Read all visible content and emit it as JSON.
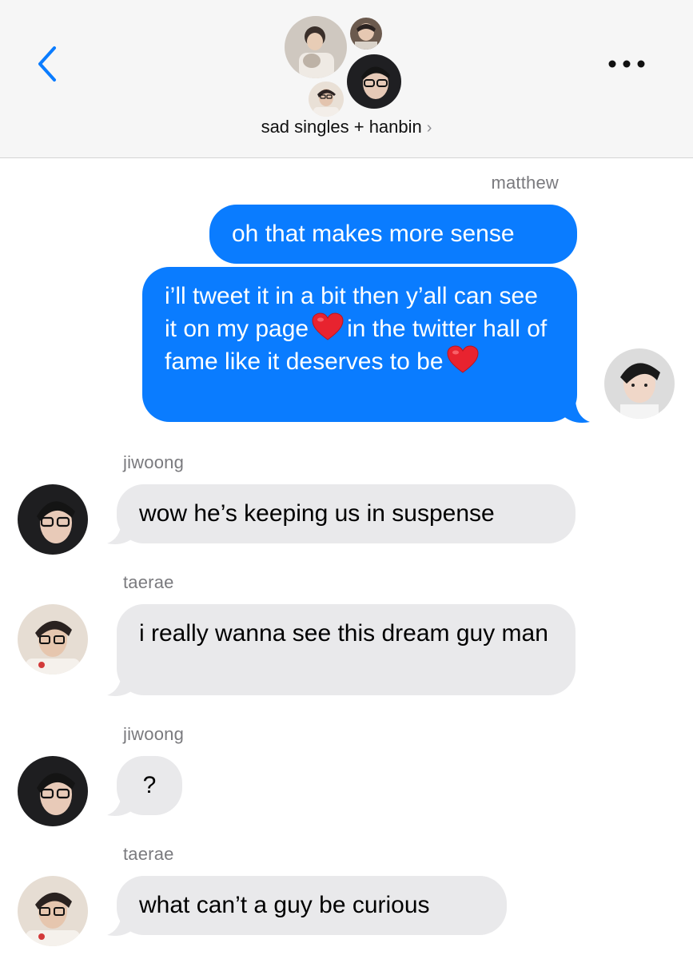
{
  "header": {
    "title": "sad singles + hanbin",
    "chevron": "›",
    "back_icon": "chevron-left-icon",
    "more_icon": "ellipsis-icon",
    "accent": "#0a7cff"
  },
  "messages": [
    {
      "sender": "matthew",
      "direction": "out",
      "text": "oh that makes more sense"
    },
    {
      "direction": "out",
      "text_parts": [
        "i’ll tweet it in a bit then y’all can see it on my page",
        "in the twitter hall of fame like it deserves to be",
        ""
      ],
      "emoji": "red-heart"
    },
    {
      "sender": "jiwoong",
      "direction": "in",
      "text": "wow he’s keeping us in suspense"
    },
    {
      "sender": "taerae",
      "direction": "in",
      "text": "i really wanna see this dream guy man"
    },
    {
      "sender": "jiwoong",
      "direction": "in",
      "text": "?"
    },
    {
      "sender": "taerae",
      "direction": "in",
      "text": "what can’t a guy be curious"
    }
  ],
  "colors": {
    "outgoing_bubble": "#0a7cff",
    "incoming_bubble": "#e9e9eb",
    "header_bg": "#f6f6f6"
  }
}
